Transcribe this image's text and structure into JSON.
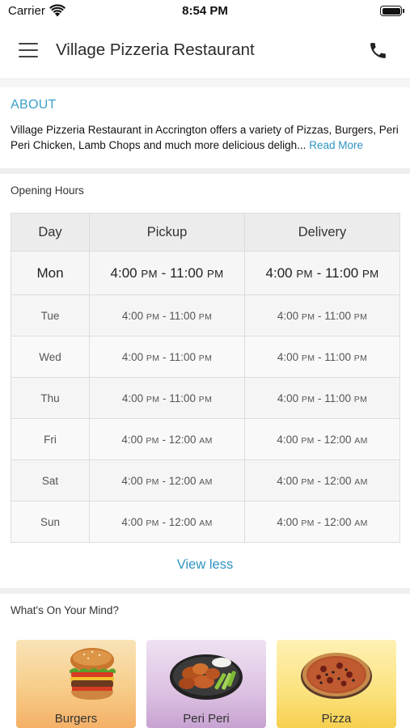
{
  "status_bar": {
    "carrier": "Carrier",
    "time": "8:54 PM"
  },
  "header": {
    "title": "Village Pizzeria Restaurant"
  },
  "about": {
    "heading": "ABOUT",
    "text": "Village Pizzeria Restaurant in Accrington offers a variety of Pizzas, Burgers, Peri Peri Chicken, Lamb Chops and much more delicious deligh...",
    "read_more": "Read More"
  },
  "hours": {
    "heading": "Opening Hours",
    "columns": [
      "Day",
      "Pickup",
      "Delivery"
    ],
    "rows": [
      {
        "day": "Mon",
        "pickup": {
          "open": "4:00",
          "open_ampm": "PM",
          "close": "11:00",
          "close_ampm": "PM"
        },
        "delivery": {
          "open": "4:00",
          "open_ampm": "PM",
          "close": "11:00",
          "close_ampm": "PM"
        }
      },
      {
        "day": "Tue",
        "pickup": {
          "open": "4:00",
          "open_ampm": "PM",
          "close": "11:00",
          "close_ampm": "PM"
        },
        "delivery": {
          "open": "4:00",
          "open_ampm": "PM",
          "close": "11:00",
          "close_ampm": "PM"
        }
      },
      {
        "day": "Wed",
        "pickup": {
          "open": "4:00",
          "open_ampm": "PM",
          "close": "11:00",
          "close_ampm": "PM"
        },
        "delivery": {
          "open": "4:00",
          "open_ampm": "PM",
          "close": "11:00",
          "close_ampm": "PM"
        }
      },
      {
        "day": "Thu",
        "pickup": {
          "open": "4:00",
          "open_ampm": "PM",
          "close": "11:00",
          "close_ampm": "PM"
        },
        "delivery": {
          "open": "4:00",
          "open_ampm": "PM",
          "close": "11:00",
          "close_ampm": "PM"
        }
      },
      {
        "day": "Fri",
        "pickup": {
          "open": "4:00",
          "open_ampm": "PM",
          "close": "12:00",
          "close_ampm": "AM"
        },
        "delivery": {
          "open": "4:00",
          "open_ampm": "PM",
          "close": "12:00",
          "close_ampm": "AM"
        }
      },
      {
        "day": "Sat",
        "pickup": {
          "open": "4:00",
          "open_ampm": "PM",
          "close": "12:00",
          "close_ampm": "AM"
        },
        "delivery": {
          "open": "4:00",
          "open_ampm": "PM",
          "close": "12:00",
          "close_ampm": "AM"
        }
      },
      {
        "day": "Sun",
        "pickup": {
          "open": "4:00",
          "open_ampm": "PM",
          "close": "12:00",
          "close_ampm": "AM"
        },
        "delivery": {
          "open": "4:00",
          "open_ampm": "PM",
          "close": "12:00",
          "close_ampm": "AM"
        }
      }
    ],
    "view_less": "View less"
  },
  "mind": {
    "heading": "What's On Your Mind?",
    "categories": [
      {
        "label": "Burgers",
        "icon": "burger-image"
      },
      {
        "label": "Peri Peri",
        "icon": "peri-peri-chicken-image"
      },
      {
        "label": "Pizza",
        "icon": "pizza-image"
      }
    ]
  },
  "colors": {
    "accent": "#3aa1c9",
    "link": "#2f93c2",
    "divider": "#efefef"
  }
}
